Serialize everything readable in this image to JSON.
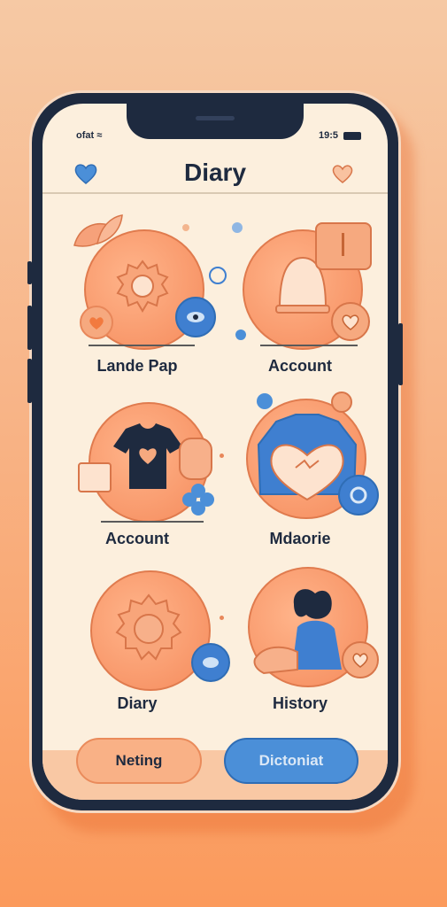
{
  "status_bar": {
    "carrier": "ofat",
    "time": "19:5"
  },
  "header": {
    "title": "Diary",
    "left_icon": "heart-icon",
    "right_icon": "heart-outline-icon"
  },
  "grid": [
    {
      "label": "Lande Pap",
      "icon": "gear-icon"
    },
    {
      "label": "Account",
      "icon": "bell-icon"
    },
    {
      "label": "Account",
      "icon": "shirt-icon"
    },
    {
      "label": "Mdaorie",
      "icon": "heart-shirt-icon"
    },
    {
      "label": "Diary",
      "icon": "gear-icon"
    },
    {
      "label": "History",
      "icon": "people-icon"
    }
  ],
  "bottom_buttons": {
    "left_label": "Neting",
    "right_label": "Dictoniat"
  },
  "colors": {
    "accent_orange": "#f58b5c",
    "accent_blue": "#4b8fd8",
    "dark": "#1e2a3f",
    "screen_bg": "#fcefdd"
  }
}
